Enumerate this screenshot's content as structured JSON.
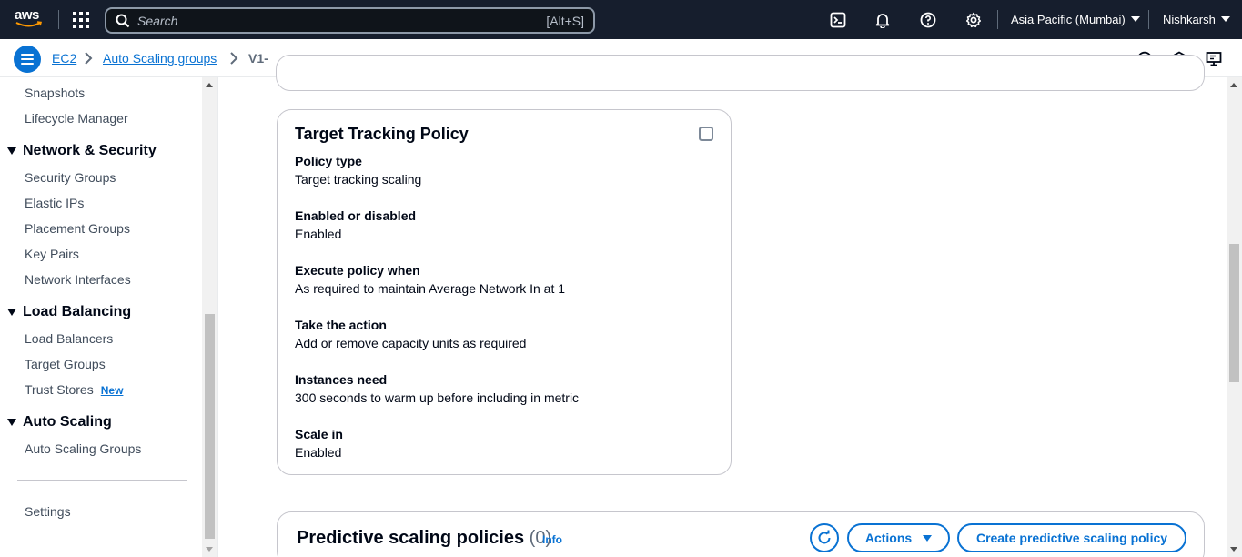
{
  "topnav": {
    "logo_text": "aws",
    "search_placeholder": "Search",
    "search_shortcut": "[Alt+S]",
    "region": "Asia Pacific (Mumbai)",
    "user": "Nishkarsh"
  },
  "breadcrumb": {
    "items": [
      "EC2",
      "Auto Scaling groups"
    ],
    "current": "V1-"
  },
  "sidebar": {
    "items_top": [
      "Snapshots",
      "Lifecycle Manager"
    ],
    "sections": [
      {
        "title": "Network & Security",
        "items": [
          "Security Groups",
          "Elastic IPs",
          "Placement Groups",
          "Key Pairs",
          "Network Interfaces"
        ]
      },
      {
        "title": "Load Balancing",
        "items": [
          "Load Balancers",
          "Target Groups",
          "Trust Stores"
        ]
      },
      {
        "title": "Auto Scaling",
        "items": [
          "Auto Scaling Groups"
        ]
      }
    ],
    "new_badge": "New",
    "settings": "Settings"
  },
  "policy_card": {
    "title": "Target Tracking Policy",
    "fields": [
      {
        "key": "Policy type",
        "value": "Target tracking scaling"
      },
      {
        "key": "Enabled or disabled",
        "value": "Enabled"
      },
      {
        "key": "Execute policy when",
        "value": "As required to maintain Average Network In at 1"
      },
      {
        "key": "Take the action",
        "value": "Add or remove capacity units as required"
      },
      {
        "key": "Instances need",
        "value": "300 seconds to warm up before including in metric"
      },
      {
        "key": "Scale in",
        "value": "Enabled"
      }
    ]
  },
  "predictive": {
    "title": "Predictive scaling policies",
    "count": "(0)",
    "info": "Info",
    "actions_label": "Actions",
    "create_label": "Create predictive scaling policy"
  },
  "colors": {
    "nav_bg": "#161e2d",
    "link": "#0972d3",
    "text": "#000716"
  }
}
